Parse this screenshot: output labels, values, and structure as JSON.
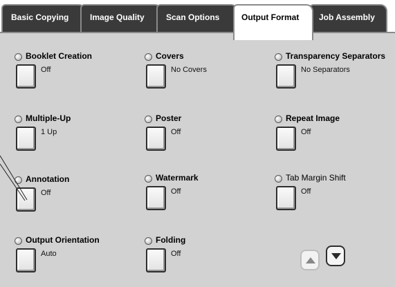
{
  "tabs": [
    {
      "label": "Basic Copying"
    },
    {
      "label": "Image Quality"
    },
    {
      "label": "Scan Options"
    },
    {
      "label": "Output Format"
    },
    {
      "label": "Job Assembly"
    }
  ],
  "active_tab": "Output Format",
  "features": {
    "booklet_creation": {
      "title": "Booklet Creation",
      "value": "Off"
    },
    "covers": {
      "title": "Covers",
      "value": "No Covers"
    },
    "transparency_separators": {
      "title": "Transparency Separators",
      "value": "No Separators"
    },
    "multiple_up": {
      "title": "Multiple-Up",
      "value": "1 Up"
    },
    "poster": {
      "title": "Poster",
      "value": "Off"
    },
    "repeat_image": {
      "title": "Repeat Image",
      "value": "Off"
    },
    "annotation": {
      "title": "Annotation",
      "value": "Off"
    },
    "watermark": {
      "title": "Watermark",
      "value": "Off"
    },
    "tab_margin_shift": {
      "title": "Tab Margin Shift",
      "value": "Off"
    },
    "output_orientation": {
      "title": "Output Orientation",
      "value": "Auto"
    },
    "folding": {
      "title": "Folding",
      "value": "Off"
    }
  },
  "scroll": {
    "up_icon": "triangle-up-icon",
    "down_icon": "triangle-down-icon",
    "up_enabled": false,
    "down_enabled": true
  },
  "colors": {
    "tab_inactive": "#3a3a3a",
    "panel": "#d2d2d2",
    "active_tab": "#ffffff"
  }
}
